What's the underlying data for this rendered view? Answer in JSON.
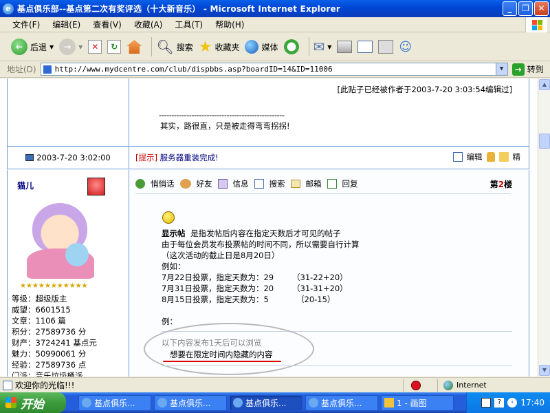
{
  "window": {
    "title": "基点俱乐部--基点第二次有奖评选（十大新音乐） - Microsoft Internet Explorer",
    "buttons": {
      "min": "_",
      "max": "❐",
      "close": "✕"
    }
  },
  "menu": [
    "文件(F)",
    "编辑(E)",
    "查看(V)",
    "收藏(A)",
    "工具(T)",
    "帮助(H)"
  ],
  "toolbar": {
    "back": "后退",
    "search": "搜索",
    "favorites": "收藏夹",
    "media": "媒体"
  },
  "address": {
    "label": "地址(D)",
    "url": "http://www.mydcentre.com/club/dispbbs.asp?boardID=14&ID=11006",
    "go": "转到"
  },
  "post1": {
    "edited_note": "[此贴子已经被作者于2003-7-20 3:03:54编辑过]",
    "dashes": "--------------------------------------------------",
    "body": "其实，路很直，只是被走得弯弯拐拐!",
    "time": "2003-7-20 3:02:00",
    "notice_tag": "[提示]",
    "notice": "服务器重装完成!",
    "edit_label": "编辑",
    "quote_label": "精"
  },
  "post2": {
    "username": "猫儿",
    "stars": "★★★★★★★★★★★",
    "stats": [
      {
        "label": "等级：",
        "value": "超级版主"
      },
      {
        "label": "威望：",
        "value": "6601515"
      },
      {
        "label": "文章：",
        "value": "1106 篇"
      },
      {
        "label": "积分：",
        "value": "27589736 分"
      },
      {
        "label": "财产：",
        "value": "3724241 基点元"
      },
      {
        "label": "魅力：",
        "value": "50990061 分"
      },
      {
        "label": "经验：",
        "value": "27589736 点"
      },
      {
        "label": "门派：",
        "value": "音乐垃圾桶派"
      }
    ],
    "actions": [
      "悄悄话",
      "好友",
      "信息",
      "搜索",
      "邮箱",
      "回复"
    ],
    "floor_prefix": "第",
    "floor_num": "2",
    "floor_suffix": "楼",
    "hint_title": "显示帖",
    "hint_desc": "是指发帖后内容在指定天数后才可见的帖子",
    "lines": [
      "由于每位会员发布投票帖的时间不同，所以需要自行计算",
      "（这次活动的截止日是8月20日）",
      "例如："
    ],
    "examples": [
      {
        "left": "7月22日投票，指定天数为：29",
        "right": "（31-22+20）"
      },
      {
        "left": "7月31日投票，指定天数为：20",
        "right": "（31-31+20）"
      },
      {
        "left": "8月15日投票，指定天数为：5",
        "right": "（20-15）"
      }
    ],
    "example_label": "例：",
    "hidden_caption": "以下内容发布1天后可以浏览",
    "hidden_text": "想要在限定时间内隐藏的内容"
  },
  "status": {
    "text": "欢迎你的光临!!!",
    "zone": "Internet"
  },
  "taskbar": {
    "start": "开始",
    "tasks": [
      "基点俱乐...",
      "基点俱乐...",
      "基点俱乐...",
      "基点俱乐...",
      "1 - 画图"
    ],
    "clock": "17:40"
  }
}
